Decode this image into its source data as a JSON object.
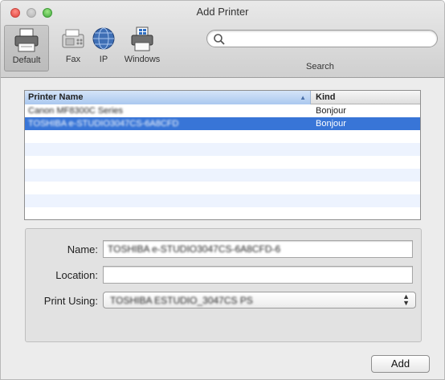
{
  "window": {
    "title": "Add Printer"
  },
  "toolbar": {
    "items": [
      {
        "label": "Default",
        "icon": "default-printer-icon"
      },
      {
        "label": "Fax",
        "icon": "fax-icon"
      },
      {
        "label": "IP",
        "icon": "globe-icon"
      },
      {
        "label": "Windows",
        "icon": "windows-printer-icon"
      }
    ],
    "search": {
      "placeholder": "",
      "label": "Search"
    }
  },
  "printer_list": {
    "columns": [
      "Printer Name",
      "Kind"
    ],
    "rows": [
      {
        "name": "Canon MF8300C Series",
        "kind": "Bonjour",
        "selected": false
      },
      {
        "name": "TOSHIBA e-STUDIO3047CS-6A8CFD",
        "kind": "Bonjour",
        "selected": true
      }
    ]
  },
  "details": {
    "name_label": "Name:",
    "name_value": "TOSHIBA e-STUDIO3047CS-6A8CFD-6",
    "location_label": "Location:",
    "location_value": "",
    "print_using_label": "Print Using:",
    "print_using_value": "TOSHIBA ESTUDIO_3047CS PS"
  },
  "buttons": {
    "add": "Add"
  },
  "colors": {
    "selection": "#3875d7",
    "stripe": "#edf3fe"
  }
}
